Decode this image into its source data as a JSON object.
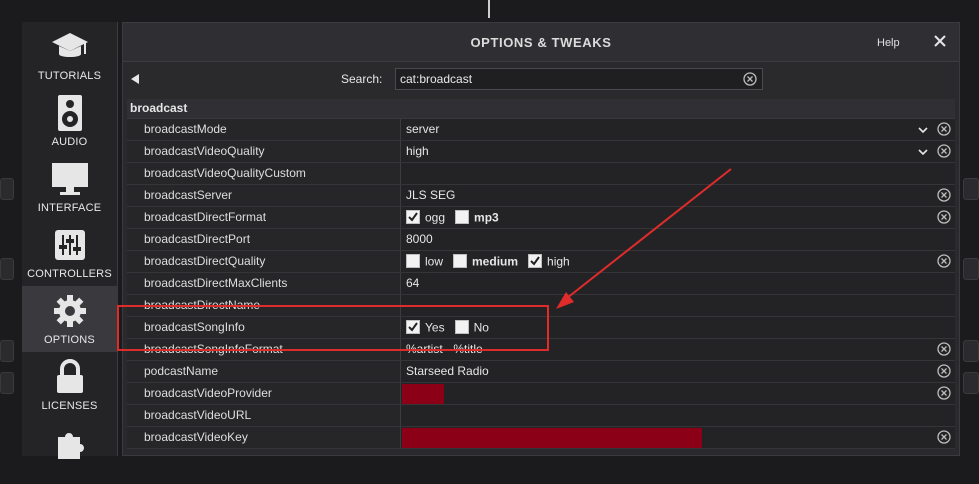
{
  "sidebar": {
    "items": [
      {
        "label": "TUTORIALS",
        "icon": "graduation-cap-icon",
        "active": false
      },
      {
        "label": "AUDIO",
        "icon": "speaker-icon",
        "active": false
      },
      {
        "label": "INTERFACE",
        "icon": "monitor-icon",
        "active": false
      },
      {
        "label": "CONTROLLERS",
        "icon": "mixer-sliders-icon",
        "active": false
      },
      {
        "label": "OPTIONS",
        "icon": "gear-icon",
        "active": true
      },
      {
        "label": "LICENSES",
        "icon": "lock-icon",
        "active": false
      },
      {
        "label": "",
        "icon": "puzzle-icon",
        "active": false
      }
    ]
  },
  "dialog": {
    "title": "OPTIONS & TWEAKS",
    "help_label": "Help",
    "search_label": "Search:",
    "search_value": "cat:broadcast"
  },
  "table": {
    "category": "broadcast",
    "rows": [
      {
        "key": "broadcastMode",
        "value": "server",
        "dropdown": true,
        "reset": true
      },
      {
        "key": "broadcastVideoQuality",
        "value": "high",
        "dropdown": true,
        "reset": true
      },
      {
        "key": "broadcastVideoQualityCustom",
        "value": "",
        "reset": false
      },
      {
        "key": "broadcastServer",
        "value": "JLS SEG",
        "reset": true
      },
      {
        "key": "broadcastDirectFormat",
        "options": [
          {
            "label": "ogg",
            "checked": true
          },
          {
            "label": "mp3",
            "checked": false
          }
        ],
        "reset": true
      },
      {
        "key": "broadcastDirectPort",
        "value": "8000",
        "reset": false
      },
      {
        "key": "broadcastDirectQuality",
        "options": [
          {
            "label": "low",
            "checked": false
          },
          {
            "label": "medium",
            "checked": false
          },
          {
            "label": "high",
            "checked": true
          }
        ],
        "reset": true
      },
      {
        "key": "broadcastDirectMaxClients",
        "value": "64",
        "reset": false
      },
      {
        "key": "broadcastDirectName",
        "value": "",
        "reset": false
      },
      {
        "key": "broadcastSongInfo",
        "options": [
          {
            "label": "Yes",
            "checked": true
          },
          {
            "label": "No",
            "checked": false
          }
        ],
        "reset": false
      },
      {
        "key": "broadcastSongInfoFormat",
        "value": "%artist - %title",
        "reset": true
      },
      {
        "key": "podcastName",
        "value": "Starseed Radio",
        "reset": true
      },
      {
        "key": "broadcastVideoProvider",
        "value": "",
        "redacted": true,
        "reset": true
      },
      {
        "key": "broadcastVideoURL",
        "value": "",
        "reset": false
      },
      {
        "key": "broadcastVideoKey",
        "value": "",
        "redacted": true,
        "reset": true
      }
    ]
  },
  "colors": {
    "annotation": "#e02b2b",
    "redaction": "#8b0016",
    "accent_bg": "#2a2a2d"
  }
}
